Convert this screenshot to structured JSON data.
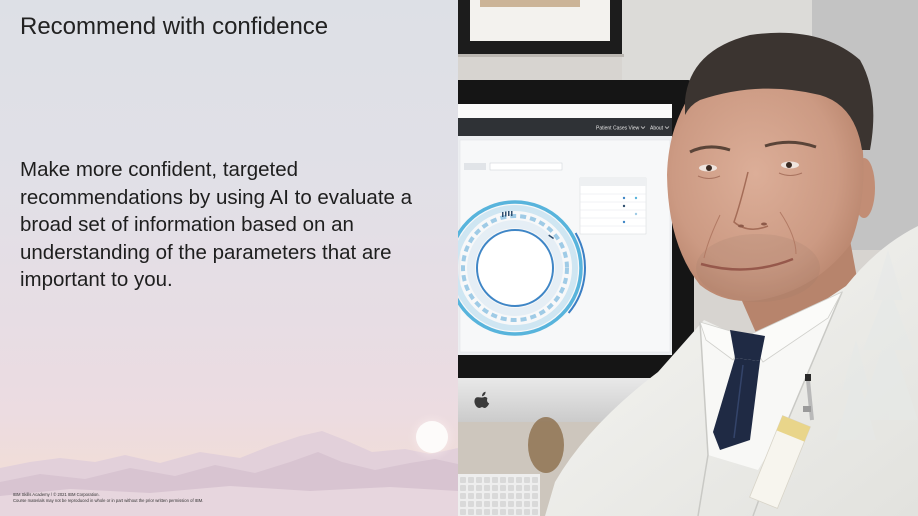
{
  "slide": {
    "title": "Recommend with confidence",
    "body_lines": [
      "Make more confident, targeted",
      "recommendations by using AI to evaluate a",
      "broad set of information based on an",
      "understanding of the parameters that are",
      "important to you."
    ],
    "footer": {
      "copyright": "IBM Skills Academy / © 2021 IBM Corporation.",
      "notice": "Course materials may not be reproduced in whole or in part without the prior written permission of IBM."
    }
  },
  "photo": {
    "monitor_app_menu": {
      "view_menu": "Patient Cases View",
      "about_menu": "About"
    },
    "monitor_logo_icon": "apple-logo-icon",
    "menu_chevron_icon": "chevron-down-icon"
  },
  "colors": {
    "text": "#222222",
    "sky_top": "#dde0e6",
    "sky_bottom": "#f0ddd9",
    "mountain": "#d8c4d1",
    "sun": "#fdfbfa",
    "coat": "#efefec",
    "tie": "#1f2a44",
    "screen_chart_blue": "#58b4dc"
  }
}
